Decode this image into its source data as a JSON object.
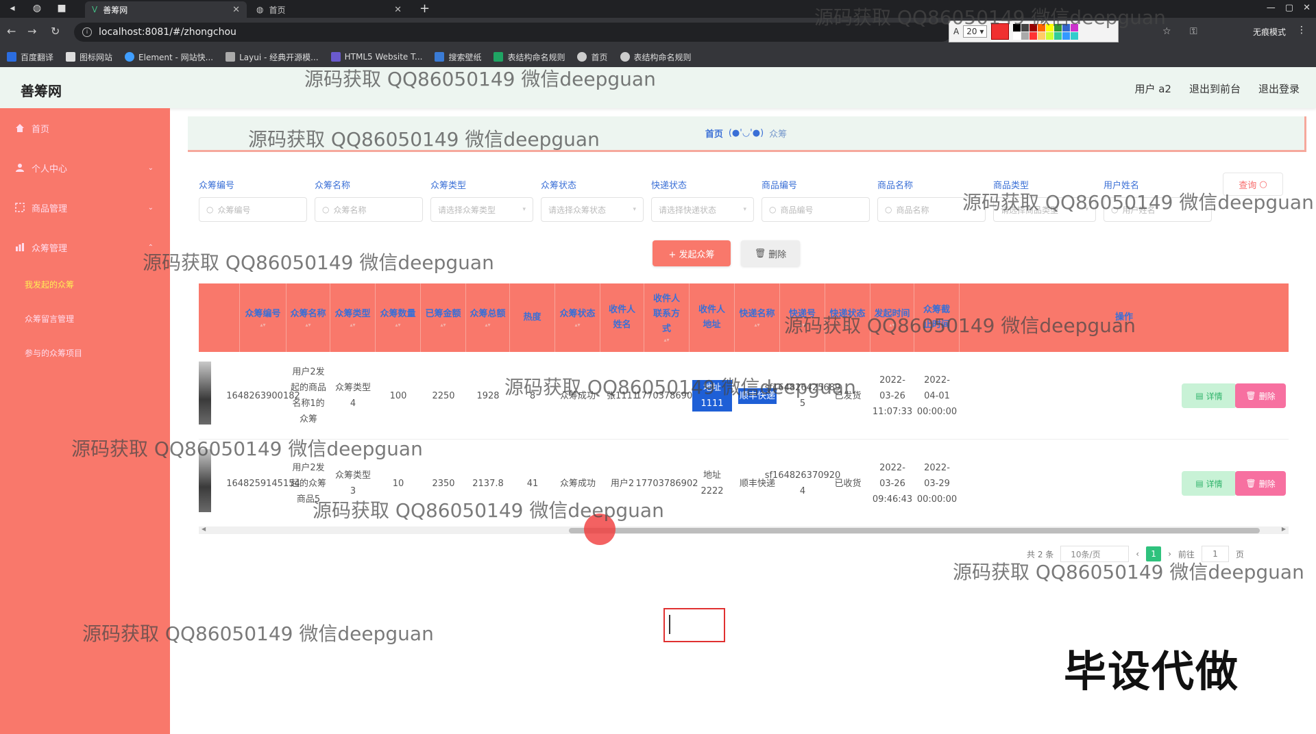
{
  "browser": {
    "tabs": [
      {
        "label": "善筹网",
        "active": true
      },
      {
        "label": "首页",
        "active": false
      }
    ],
    "url": "localhost:8081/#/zhongchou",
    "incognito_label": "无痕模式",
    "bookmarks": [
      "百度翻译",
      "图标网站",
      "Element - 网站快...",
      "Layui - 经典开源模...",
      "HTML5 Website T...",
      "搜索壁纸",
      "表结构命名规则",
      "首页",
      "表结构命名规则"
    ],
    "annot_size": "20"
  },
  "header": {
    "brand": "善筹网",
    "user": "用户 a2",
    "to_front": "退出到前台",
    "logout": "退出登录"
  },
  "sidebar": {
    "items": [
      {
        "label": "首页",
        "icon": "home-icon"
      },
      {
        "label": "个人中心",
        "icon": "user-icon"
      },
      {
        "label": "商品管理",
        "icon": "goods-icon"
      },
      {
        "label": "众筹管理",
        "icon": "crowdfund-icon"
      }
    ],
    "sub_items": [
      "我发起的众筹",
      "众筹留言管理",
      "参与的众筹项目"
    ]
  },
  "breadcrumb": {
    "home": "首页",
    "sep": "(●'◡'●)",
    "current": "众筹"
  },
  "filters": {
    "labels": [
      "众筹编号",
      "众筹名称",
      "众筹类型",
      "众筹状态",
      "快递状态",
      "商品编号",
      "商品名称",
      "商品类型",
      "用户姓名"
    ],
    "placeholders": [
      "众筹编号",
      "众筹名称",
      "请选择众筹类型",
      "请选择众筹状态",
      "请选择快递状态",
      "商品编号",
      "商品名称",
      "请选择商品类型",
      "用户姓名"
    ],
    "query_label": "查询"
  },
  "actions": {
    "add_label": "+ 发起众筹",
    "delete_label": "删除"
  },
  "table": {
    "headers": [
      "众筹编号",
      "众筹名称",
      "众筹类型",
      "众筹数量",
      "已筹金额",
      "众筹总额",
      "热度",
      "众筹状态",
      "收件人姓名",
      "收件人联系方式",
      "收件人地址",
      "快递名称",
      "快递号",
      "快递状态",
      "发起时间",
      "众筹截止时间",
      "操作"
    ],
    "rows": [
      {
        "id": "1648263900182",
        "name": "用户2发起的商品名称1的众筹",
        "type": "众筹类型4",
        "qty": "100",
        "raised": "2250",
        "total": "1928",
        "heat": "8",
        "status": "众筹成功",
        "recipient": "张1111",
        "phone": "17703786909",
        "address": "地址1111",
        "courier": "顺丰快递",
        "tracking": "sf164826425689 5",
        "ship_status": "已发货",
        "start": "2022-03-26 11:07:33",
        "end": "2022-04-01 00:00:00"
      },
      {
        "id": "1648259145154",
        "name": "用户2发起的众筹商品5",
        "type": "众筹类型3",
        "qty": "10",
        "raised": "2350",
        "total": "2137.8",
        "heat": "41",
        "status": "众筹成功",
        "recipient": "用户2",
        "phone": "17703786902",
        "address": "地址2222",
        "courier": "顺丰快递",
        "tracking": "sf164826370920 4",
        "ship_status": "已收货",
        "start": "2022-03-26 09:46:43",
        "end": "2022-03-29 00:00:00"
      }
    ],
    "detail_label": "详情",
    "delete_label": "删除"
  },
  "pagination": {
    "total": "共 2 条",
    "page_size": "10条/页",
    "current": "1",
    "goto": "前往",
    "goto_value": "1",
    "page_unit": "页"
  },
  "watermark": "源码获取 QQ86050149 微信deepguan",
  "stamp": "毕设代做",
  "colors": {
    "sidebar": "#f9786b",
    "header_bg": "#edf5f0",
    "accent_blue": "#3a6fd6",
    "pager_active": "#2fc27d",
    "delete_pink": "#f770a0"
  }
}
